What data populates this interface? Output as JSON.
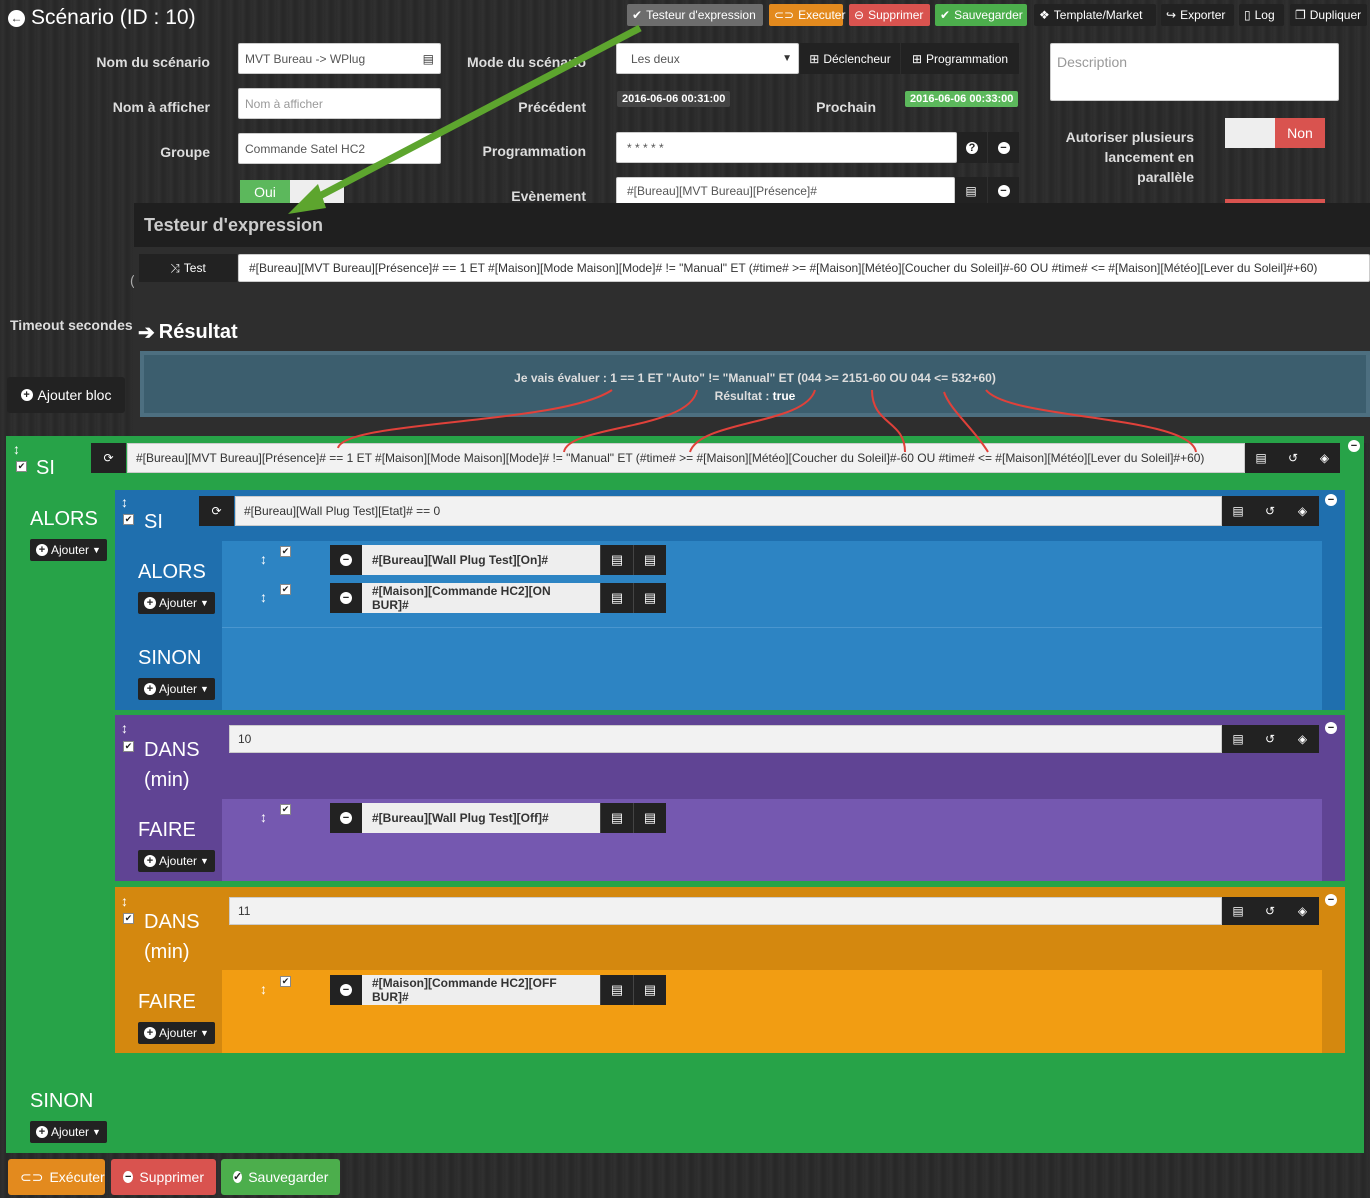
{
  "title": "Scénario (ID : 10)",
  "toolbar": {
    "tester": "Testeur d'expression",
    "execute": "Executer",
    "delete": "Supprimer",
    "save": "Sauvegarder",
    "template": "Template/Market",
    "export": "Exporter",
    "log": "Log",
    "duplicate": "Dupliquer"
  },
  "form": {
    "name_label": "Nom du scénario",
    "name_value": "MVT Bureau -> WPlug",
    "display_label": "Nom à afficher",
    "display_placeholder": "Nom à afficher",
    "group_label": "Groupe",
    "group_value": "Commande Satel HC2",
    "mode_label": "Mode du scénario",
    "mode_value": "Les deux",
    "trigger_btn": "Déclencheur",
    "schedule_btn": "Programmation",
    "prev_label": "Précédent",
    "prev_value": "2016-06-06 00:31:00",
    "next_label": "Prochain",
    "next_value": "2016-06-06 00:33:00",
    "prog_label": "Programmation",
    "prog_value": "* * * * *",
    "event_label": "Evènement",
    "event_value": "#[Bureau][MVT Bureau][Présence]#",
    "desc_placeholder": "Description",
    "parallel_label_1": "Autoriser plusieurs",
    "parallel_label_2": "lancement en",
    "parallel_label_3": "parallèle",
    "parallel_value": "Non",
    "active_yes": "Oui",
    "timeout_label": "Timeout secondes",
    "add_block": "Ajouter bloc"
  },
  "tester": {
    "title": "Testeur d'expression",
    "test_btn": "Test",
    "expression": "#[Bureau][MVT Bureau][Présence]# == 1 ET #[Maison][Mode Maison][Mode]# != \"Manual\" ET (#time# >= #[Maison][Météo][Coucher du Soleil]#-60 OU #time# <= #[Maison][Météo][Lever du Soleil]#+60)",
    "result_title": "Résultat",
    "eval_line": "Je vais évaluer : 1 == 1 ET \"Auto\" != \"Manual\" ET (044 >= 2151-60 OU 044 <= 532+60)",
    "result_label": "Résultat : ",
    "result_value": "true"
  },
  "blocks": {
    "si_label": "SI",
    "alors_label": "ALORS",
    "sinon_label": "SINON",
    "dans_label": "DANS",
    "min_label": "(min)",
    "faire_label": "FAIRE",
    "add_label": "Ajouter",
    "main_condition": "#[Bureau][MVT Bureau][Présence]# == 1 ET #[Maison][Mode Maison][Mode]# != \"Manual\" ET (#time# >= #[Maison][Météo][Coucher du Soleil]#-60 OU #time# <= #[Maison][Météo][Lever du Soleil]#+60)",
    "inner_condition": "#[Bureau][Wall Plug Test][Etat]# == 0",
    "action_on": "#[Bureau][Wall Plug Test][On]#",
    "action_on_bur": "#[Maison][Commande HC2][ON BUR]#",
    "dans1_value": "10",
    "action_off": "#[Bureau][Wall Plug Test][Off]#",
    "dans2_value": "11",
    "action_off_bur": "#[Maison][Commande HC2][OFF BUR]#"
  },
  "bottom": {
    "execute": "Exécuter",
    "delete": "Supprimer",
    "save": "Sauvegarder"
  },
  "colors": {
    "green": "#27a348",
    "blue": "#1f6fae",
    "purple": "#604494",
    "orange": "#d4880f",
    "annotation_arrow": "#5da52e",
    "annotation_curves": "#e0413a"
  }
}
